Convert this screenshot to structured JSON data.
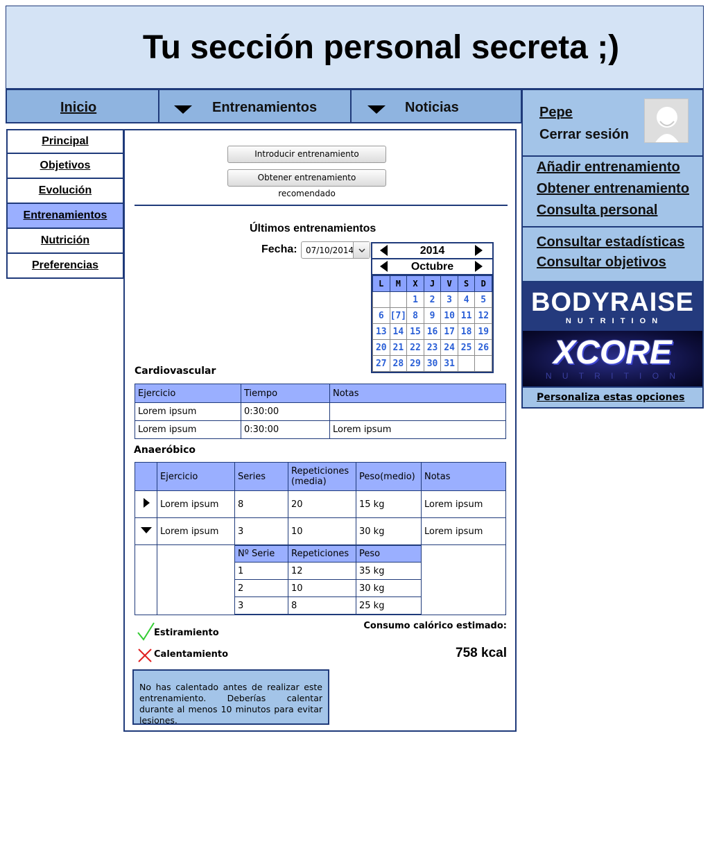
{
  "header": {
    "title": "Tu sección personal secreta ;)"
  },
  "topnav": {
    "home": "Inicio",
    "trainings": "Entrenamientos",
    "news": "Noticias"
  },
  "leftmenu": [
    "Principal",
    "Objetivos",
    "Evolución",
    "Entrenamientos",
    "Nutrición",
    "Preferencias"
  ],
  "user": {
    "name": "Pepe",
    "logout": "Cerrar sesión"
  },
  "quicklinks": [
    "Añadir entrenamiento",
    "Obtener entrenamiento",
    "Consulta personal"
  ],
  "stats_links": [
    "Consultar estadísticas",
    "Consultar objetivos"
  ],
  "ads": {
    "brand1": "BODYRAISE",
    "brand1_sub": "N U T R I T I O N",
    "brand2": "XCORE",
    "brand2_sub": "N U T R I T I O N"
  },
  "customize": "Personaliza estas opciones",
  "main": {
    "btn_add": "Introducir entrenamiento",
    "btn_recommend": "Obtener entrenamiento recomendado",
    "last_title": "Últimos entrenamientos",
    "date_label": "Fecha:",
    "date_value": "07/10/2014",
    "cardio_label": "Cardiovascular",
    "cardio_headers": [
      "Ejercicio",
      "Tiempo",
      "Notas"
    ],
    "cardio_rows": [
      [
        "Lorem ipsum",
        "0:30:00",
        ""
      ],
      [
        "Lorem ipsum",
        "0:30:00",
        "Lorem ipsum"
      ]
    ],
    "anaer_label": "Anaeróbico",
    "anaer_headers": [
      "Ejercicio",
      "Series",
      "Repeticiones (media)",
      "Peso(medio)",
      "Notas"
    ],
    "anaer_rows": [
      [
        "Lorem ipsum",
        "8",
        "20",
        "15 kg",
        "Lorem ipsum"
      ],
      [
        "Lorem ipsum",
        "3",
        "10",
        "30 kg",
        "Lorem ipsum"
      ]
    ],
    "sub_headers": [
      "Nº Serie",
      "Repeticiones",
      "Peso"
    ],
    "sub_rows": [
      [
        "1",
        "12",
        "35 kg"
      ],
      [
        "2",
        "10",
        "30 kg"
      ],
      [
        "3",
        "8",
        "25 kg"
      ]
    ],
    "stretch_label": "Estiramiento",
    "warmup_label": "Calentamiento",
    "calorie_label": "Consumo calórico estimado:",
    "calorie_value": "758 kcal",
    "warning": "No has calentado antes de realizar este entrenamiento. Deberías calentar durante al menos 10 minutos para evitar lesiones."
  },
  "calendar": {
    "year": "2014",
    "month": "Octubre",
    "weekdays": [
      "L",
      "M",
      "X",
      "J",
      "V",
      "S",
      "D"
    ],
    "weeks": [
      [
        "",
        "",
        "1",
        "2",
        "3",
        "4",
        "5"
      ],
      [
        "6",
        "[7]",
        "8",
        "9",
        "10",
        "11",
        "12"
      ],
      [
        "13",
        "14",
        "15",
        "16",
        "17",
        "18",
        "19"
      ],
      [
        "20",
        "21",
        "22",
        "23",
        "24",
        "25",
        "26"
      ],
      [
        "27",
        "28",
        "29",
        "30",
        "31",
        "",
        ""
      ]
    ]
  }
}
